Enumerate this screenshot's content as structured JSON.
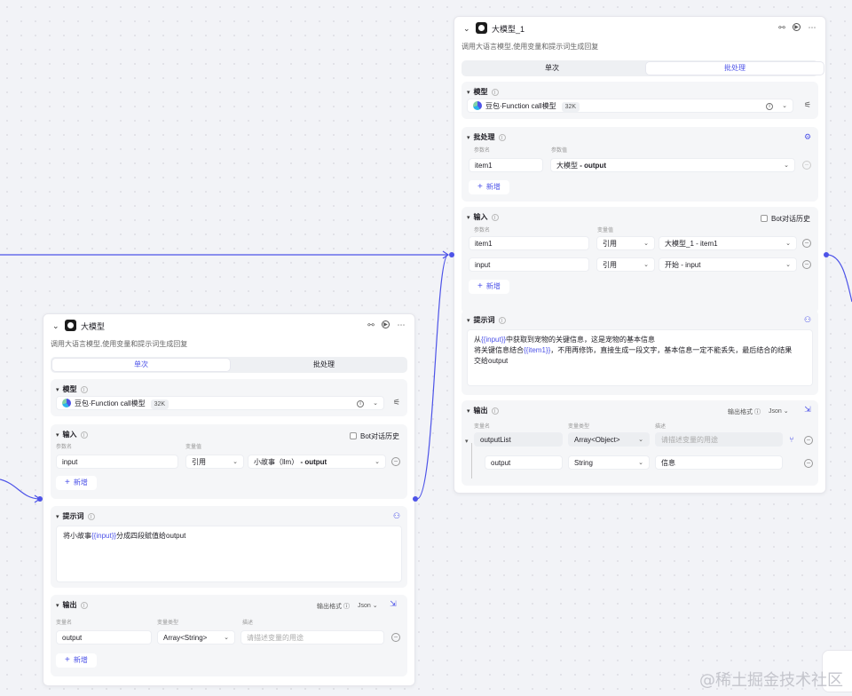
{
  "node_top": {
    "title": "大模型_1",
    "description": "调用大语言模型,使用变量和提示词生成回复",
    "tabs": [
      {
        "label": "单次"
      },
      {
        "label": "批处理"
      }
    ],
    "model_section": {
      "title": "模型",
      "model_name": "豆包·Function call模型",
      "tag": "32K"
    },
    "batch_section": {
      "title": "批处理",
      "col_name": "参数名",
      "col_value": "参数值",
      "rows": [
        {
          "name": "item1",
          "value_prefix": "大模型",
          "value_suffix": " - output"
        }
      ],
      "add_label": "新增"
    },
    "input_section": {
      "title": "输入",
      "bot_history": "Bot对话历史",
      "col_name": "参数名",
      "col_value": "变量值",
      "rows": [
        {
          "name": "item1",
          "type": "引用",
          "value": "大模型_1 - item1"
        },
        {
          "name": "input",
          "type": "引用",
          "value": "开始 - input"
        }
      ],
      "add_label": "新增"
    },
    "prompt_section": {
      "title": "提示词",
      "line1_pre": "从",
      "line1_var": "{{input}}",
      "line1_post": "中获取到宠物的关键信息，这是宠物的基本信息",
      "line2_pre": "将关键信息结合",
      "line2_var": "{{item1}}",
      "line2_post": "，不用再修饰，直接生成一段文字，基本信息一定不能丢失，最后结合的结果",
      "line3": "交给output"
    },
    "output_section": {
      "title": "输出",
      "format_label": "输出格式",
      "format_value": "Json",
      "col_name": "变量名",
      "col_type": "变量类型",
      "col_desc": "描述",
      "rows": [
        {
          "name": "outputList",
          "type": "Array<Object>",
          "desc": "请描述变量的用途"
        },
        {
          "name": "output",
          "type": "String",
          "desc": "信息"
        }
      ]
    }
  },
  "node_bottom": {
    "title": "大模型",
    "description": "调用大语言模型,使用变量和提示词生成回复",
    "tabs": [
      {
        "label": "单次"
      },
      {
        "label": "批处理"
      }
    ],
    "model_section": {
      "title": "模型",
      "model_name": "豆包·Function call模型",
      "tag": "32K"
    },
    "input_section": {
      "title": "输入",
      "bot_history": "Bot对话历史",
      "col_name": "参数名",
      "col_value": "变量值",
      "rows": [
        {
          "name": "input",
          "type": "引用",
          "value_prefix": "小故事（llm）",
          "value_suffix": " - output"
        }
      ],
      "add_label": "新增"
    },
    "prompt_section": {
      "title": "提示词",
      "pre": "将小故事",
      "var": "{{input}}",
      "post": "分成四段赋值给output"
    },
    "output_section": {
      "title": "输出",
      "format_label": "输出格式",
      "format_value": "Json",
      "col_name": "变量名",
      "col_type": "变量类型",
      "col_desc": "描述",
      "rows": [
        {
          "name": "output",
          "type": "Array<String>",
          "desc": "请描述变量的用途"
        }
      ],
      "add_label": "新增"
    }
  },
  "watermark": "@稀土掘金技术社区",
  "colors": {
    "accent": "#4d53e8",
    "canvas": "#f2f3f7",
    "section": "#f5f6f8"
  }
}
